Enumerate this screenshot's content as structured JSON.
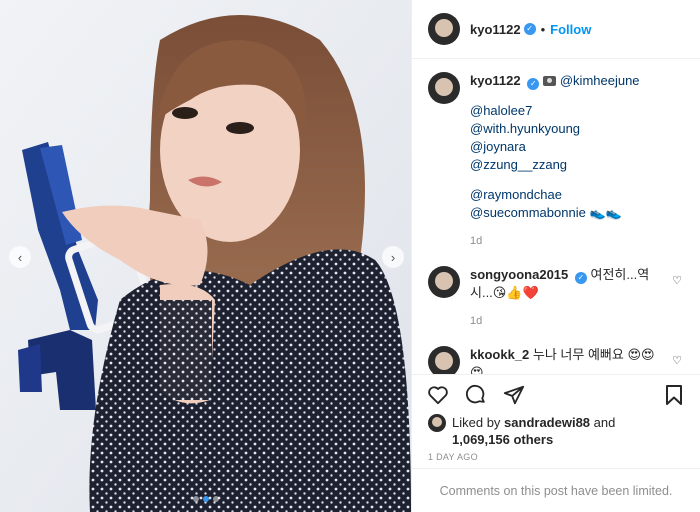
{
  "post": {
    "author": "kyo1122",
    "follow_label": "Follow",
    "verified_glyph": "✓",
    "separator": "•",
    "carousel": {
      "prev_glyph": "‹",
      "next_glyph": "›",
      "slide_count": 3,
      "active_slide": 1
    }
  },
  "caption": {
    "author": "kyo1122",
    "photographer": "@kimheejune",
    "mentions": [
      "@halolee7",
      "@with.hyunkyoung",
      "@joynara",
      "@zzung__zzang"
    ],
    "mentions2": [
      "@raymondchae",
      "@suecommabonnie"
    ],
    "trailing_emoji": "👟👟",
    "time": "1d"
  },
  "comments": [
    {
      "user": "songyoona2015",
      "text": "여전히...역시...😘👍❤️",
      "time": "1d",
      "heart": "♡"
    },
    {
      "user": "kkookk_2",
      "text": "누나 너무 예뻐요 😍😍😍",
      "heart": "♡"
    }
  ],
  "likes": {
    "prefix": "Liked by",
    "user": "sandradewi88",
    "middle": "and",
    "count": "1,069,156 others"
  },
  "timestamp": "1 DAY AGO",
  "comments_limited": "Comments on this post have been limited.",
  "icons": [
    "heart-icon",
    "comment-icon",
    "share-icon",
    "bookmark-icon",
    "verified-icon",
    "camera-icon"
  ],
  "colors": {
    "accent": "#0095f6",
    "verified": "#3897f0",
    "muted": "#8e8e8e",
    "border": "#efefef"
  }
}
